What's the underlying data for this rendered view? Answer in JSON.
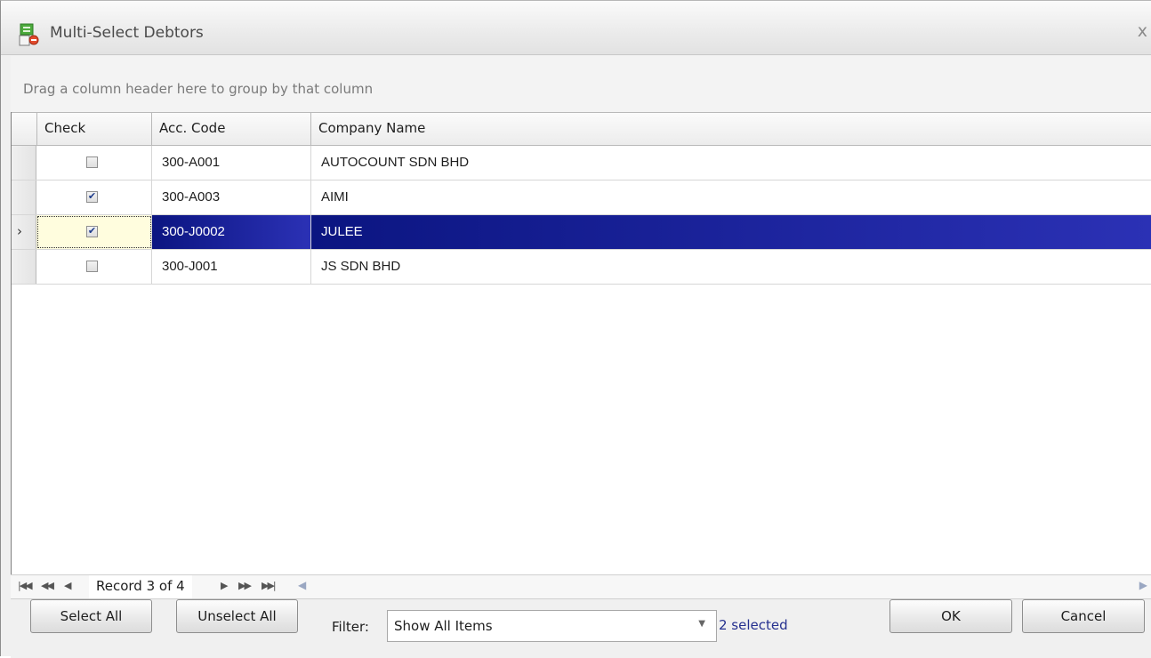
{
  "window": {
    "title": "Multi-Select Debtors",
    "close_glyph": "x"
  },
  "group_panel": {
    "hint": "Drag a column header here to group by that column"
  },
  "grid": {
    "columns": [
      {
        "label": "Check"
      },
      {
        "label": "Acc. Code"
      },
      {
        "label": "Company Name"
      }
    ],
    "rows": [
      {
        "checked": false,
        "acc_code": "300-A001",
        "company_name": "AUTOCOUNT SDN BHD"
      },
      {
        "checked": true,
        "acc_code": "300-A003",
        "company_name": "AIMI"
      },
      {
        "checked": true,
        "acc_code": "300-J0002",
        "company_name": "JULEE",
        "selected": true
      },
      {
        "checked": false,
        "acc_code": "300-J001",
        "company_name": "JS SDN BHD"
      }
    ]
  },
  "navigator": {
    "record_text": "Record 3 of 4"
  },
  "bottom": {
    "select_all_label": "Select All",
    "unselect_all_label": "Unselect All",
    "filter_label": "Filter:",
    "filter_value": "Show All Items",
    "selected_count": "2 selected",
    "ok_label": "OK",
    "cancel_label": "Cancel"
  },
  "colors": {
    "selection": "#1a1f9c",
    "count_text": "#25308f"
  },
  "icons": [
    "app-icon",
    "close-icon",
    "row-indicator-arrow-icon",
    "checkbox-icon",
    "first-record-icon",
    "prev-page-icon",
    "prev-record-icon",
    "next-record-icon",
    "next-page-icon",
    "last-record-icon",
    "chevron-down-icon"
  ]
}
